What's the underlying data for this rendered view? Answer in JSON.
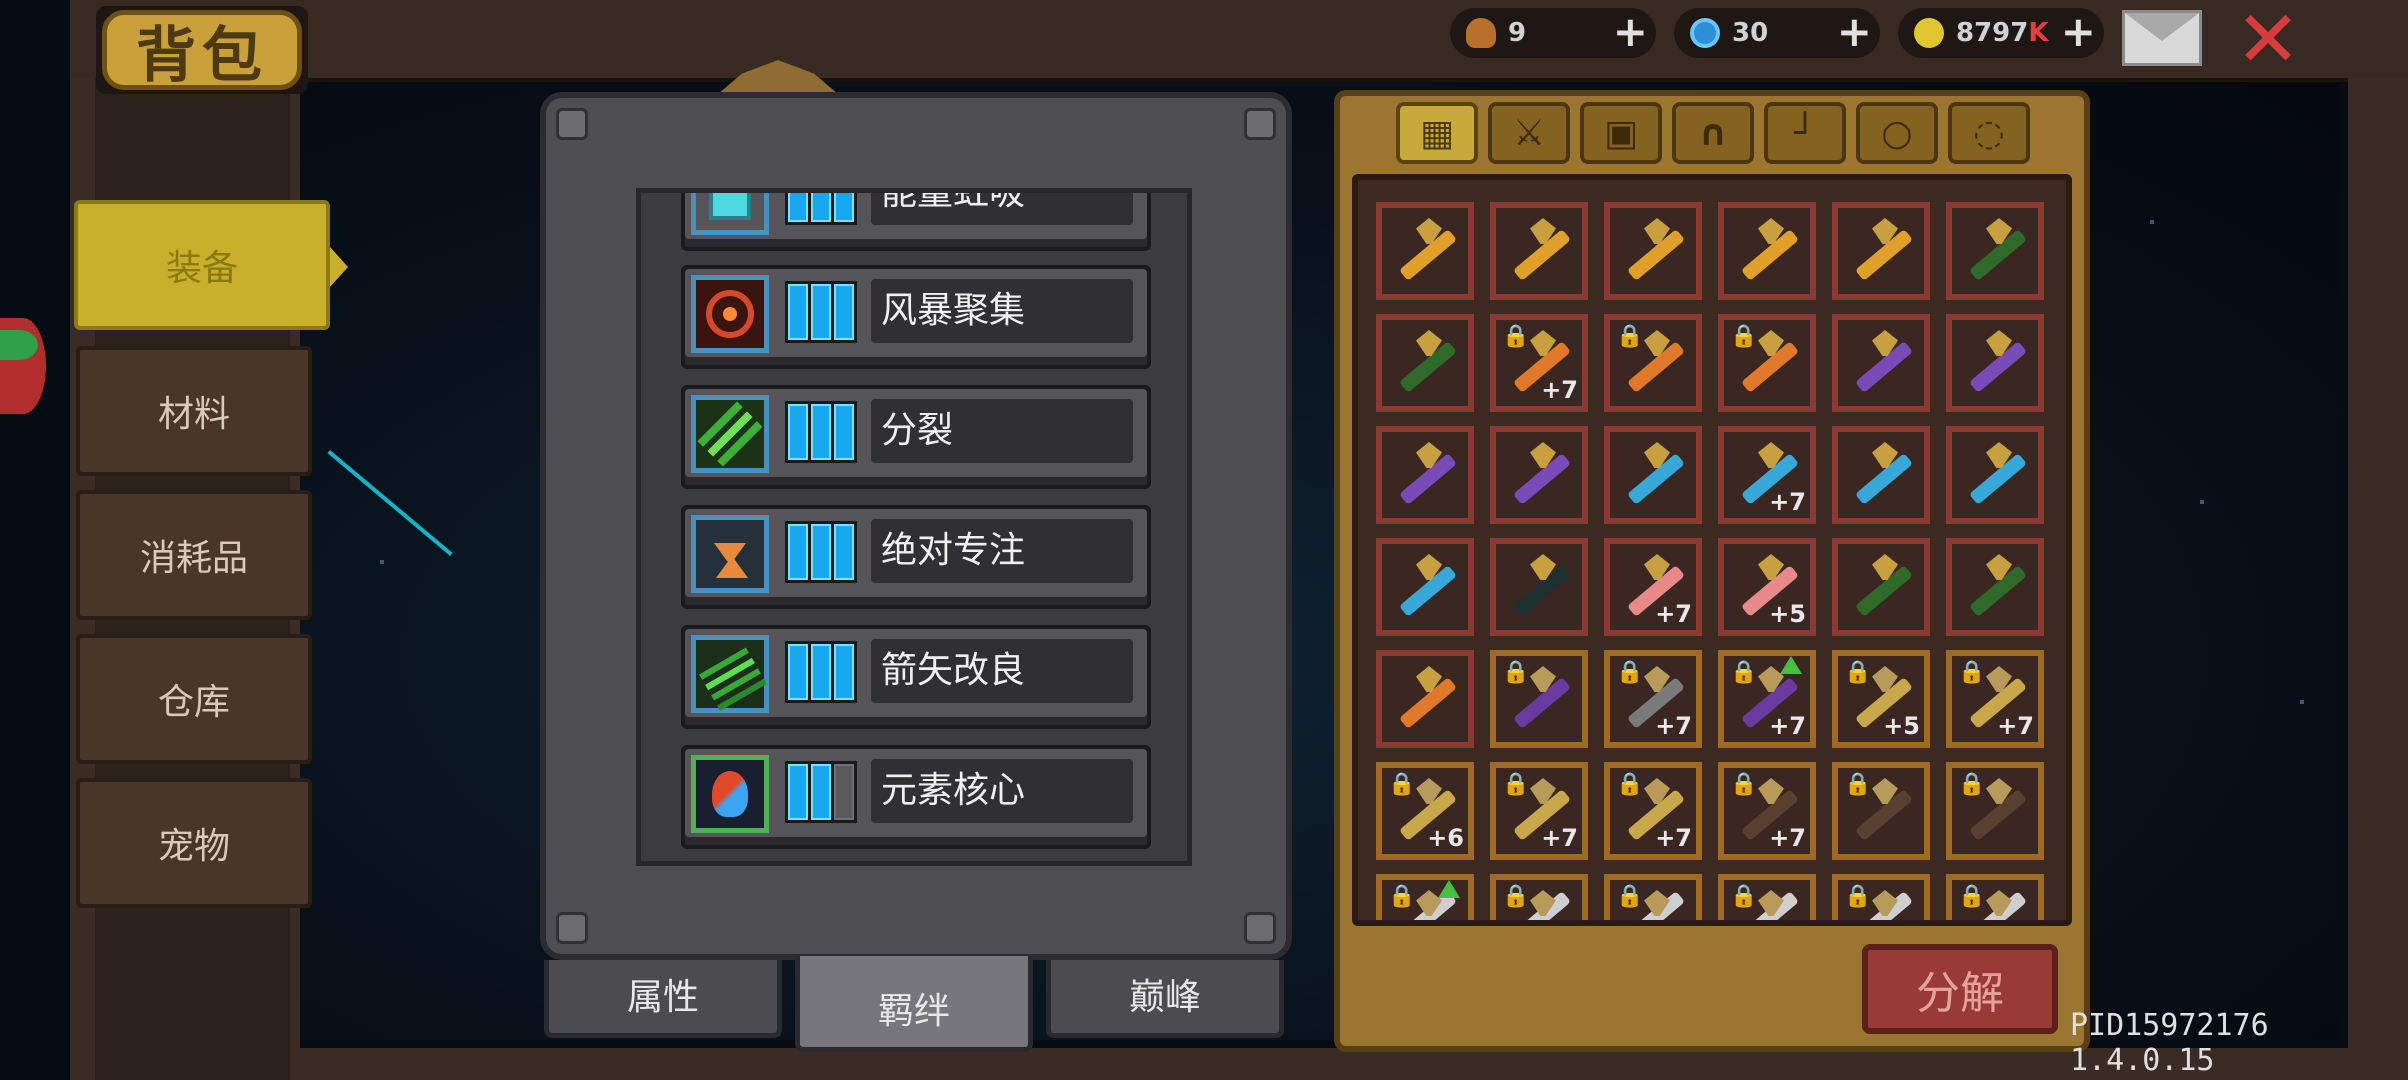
{
  "header": {
    "title": "背包",
    "resources": [
      {
        "icon": "material-icon",
        "value": "9"
      },
      {
        "icon": "gem-icon",
        "value": "30"
      },
      {
        "icon": "gold-coin-icon",
        "value": "8797",
        "suffix": "K"
      }
    ],
    "plus": "+"
  },
  "sidebar": {
    "items": [
      {
        "label": "装备",
        "active": true
      },
      {
        "label": "材料"
      },
      {
        "label": "消耗品"
      },
      {
        "label": "仓库"
      },
      {
        "label": "宠物"
      }
    ]
  },
  "bonds": {
    "items": [
      {
        "name": "能量虹吸",
        "icon": "energy-siphon-icon",
        "level": 3
      },
      {
        "name": "风暴聚集",
        "icon": "storm-gather-icon",
        "level": 3
      },
      {
        "name": "分裂",
        "icon": "split-arrows-icon",
        "level": 3
      },
      {
        "name": "绝对专注",
        "icon": "hourglass-icon",
        "level": 3
      },
      {
        "name": "箭矢改良",
        "icon": "arrow-upgrade-icon",
        "level": 3
      },
      {
        "name": "元素核心",
        "icon": "element-core-icon",
        "level": 2
      }
    ],
    "max_level": 3,
    "tabs": [
      {
        "label": "属性"
      },
      {
        "label": "羁绊",
        "active": true
      },
      {
        "label": "巅峰"
      }
    ]
  },
  "inventory": {
    "filter_tabs": [
      "all-grid-icon",
      "weapon-icon",
      "armor-icon",
      "helmet-icon",
      "boots-icon",
      "ring-icon",
      "amulet-icon"
    ],
    "cells": [
      {
        "t": "bow-gold"
      },
      {
        "t": "bow-gold"
      },
      {
        "t": "bow-gold"
      },
      {
        "t": "bow-gold"
      },
      {
        "t": "bow-gold"
      },
      {
        "t": "bow-green"
      },
      {
        "t": "bow-green"
      },
      {
        "t": "sword-fire",
        "lock": true,
        "lv": "+7"
      },
      {
        "t": "sword-fire",
        "lock": true
      },
      {
        "t": "sword-fire",
        "lock": true
      },
      {
        "t": "bow-purple"
      },
      {
        "t": "bow-purple"
      },
      {
        "t": "bow-purple"
      },
      {
        "t": "bow-purple"
      },
      {
        "t": "wing-blue"
      },
      {
        "t": "wing-blue",
        "lv": "+7"
      },
      {
        "t": "wing-blue"
      },
      {
        "t": "wing-blue"
      },
      {
        "t": "wing-blue"
      },
      {
        "t": "armor-dark"
      },
      {
        "t": "crystal",
        "lv": "+7"
      },
      {
        "t": "crystal",
        "lv": "+5"
      },
      {
        "t": "bow-green"
      },
      {
        "t": "bow-green"
      },
      {
        "t": "sword-fire"
      },
      {
        "t": "armor-purple",
        "lock": true,
        "gold": true
      },
      {
        "t": "armor-gray",
        "lock": true,
        "gold": true,
        "lv": "+7"
      },
      {
        "t": "armor-purple",
        "lock": true,
        "gold": true,
        "up": true,
        "lv": "+7"
      },
      {
        "t": "key-gold",
        "lock": true,
        "gold": true,
        "lv": "+5"
      },
      {
        "t": "key-gold",
        "lock": true,
        "gold": true,
        "lv": "+7"
      },
      {
        "t": "key-gold",
        "lock": true,
        "gold": true,
        "lv": "+6"
      },
      {
        "t": "key-gold",
        "lock": true,
        "gold": true,
        "lv": "+7"
      },
      {
        "t": "key-gold",
        "lock": true,
        "gold": true,
        "lv": "+7"
      },
      {
        "t": "boot-dark",
        "lock": true,
        "gold": true,
        "lv": "+7"
      },
      {
        "t": "boot-dark",
        "lock": true,
        "gold": true
      },
      {
        "t": "boot-dark",
        "lock": true,
        "gold": true
      },
      {
        "t": "ring",
        "lock": true,
        "gold": true,
        "up": true
      },
      {
        "t": "ring",
        "lock": true,
        "gold": true
      },
      {
        "t": "ring",
        "lock": true,
        "gold": true
      },
      {
        "t": "ring",
        "lock": true,
        "gold": true
      },
      {
        "t": "ring",
        "lock": true,
        "gold": true
      },
      {
        "t": "ring",
        "lock": true,
        "gold": true
      }
    ],
    "decompose_label": "分解"
  },
  "footer": {
    "pid": "PID15972176 1.4.0.15"
  },
  "colors": {
    "accent_gold": "#c8b02c",
    "bar_blue": "#18a8f0",
    "decompose_red": "#9a3a36"
  }
}
